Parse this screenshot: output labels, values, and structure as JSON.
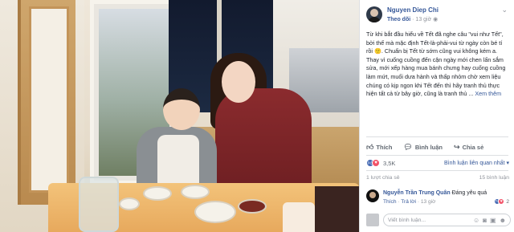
{
  "post_header": {
    "author": "Nguyen Diep Chi",
    "follow_label": "Theo dõi",
    "separator": "·",
    "time": "13 giờ",
    "audience_icon": "globe-icon",
    "menu_icon": "chevron-down-icon"
  },
  "post": {
    "text": "Từ khi bắt đầu hiểu về Tết đã nghe câu \"vui như Tết\", bởi thế mà mặc định Tết-là-phải-vui từ ngày còn bé tí rồi 🙂. Chuẩn bị Tết từ sớm cũng vui không kém a. Thay vì cuống cuồng đến cận ngày mới chen lấn sắm sửa, mới xếp hàng mua bánh chưng hay cuống cuồng làm mứt, muối dưa hành và thấp nhỏm chờ xem liệu chúng có kịp ngon khi Tết đến thì hãy tranh thủ thực hiện tất cả từ bây giờ, cũng là tranh thủ ...",
    "see_more": "Xem thêm"
  },
  "actions": {
    "like": "Thích",
    "comment": "Bình luận",
    "share": "Chia sẻ"
  },
  "reactions": {
    "count": "3,5K",
    "sort_label": "Bình luận liên quan nhất",
    "sort_icon": "chevron-down-icon"
  },
  "stats": {
    "shares": "1 lượt chia sẻ",
    "comments": "15 bình luận"
  },
  "comment": {
    "author": "Nguyễn Trần Trung Quân",
    "text": "Đáng yêu quá",
    "like_link": "Thích",
    "reply_link": "Trả lời",
    "time": "13 giờ",
    "reaction_count": "2"
  },
  "composer": {
    "placeholder": "Viết bình luận..."
  },
  "colors": {
    "link_blue": "#365899",
    "like_blue": "#4267b2",
    "love_red": "#f25268",
    "muted_gray": "#90949c"
  }
}
